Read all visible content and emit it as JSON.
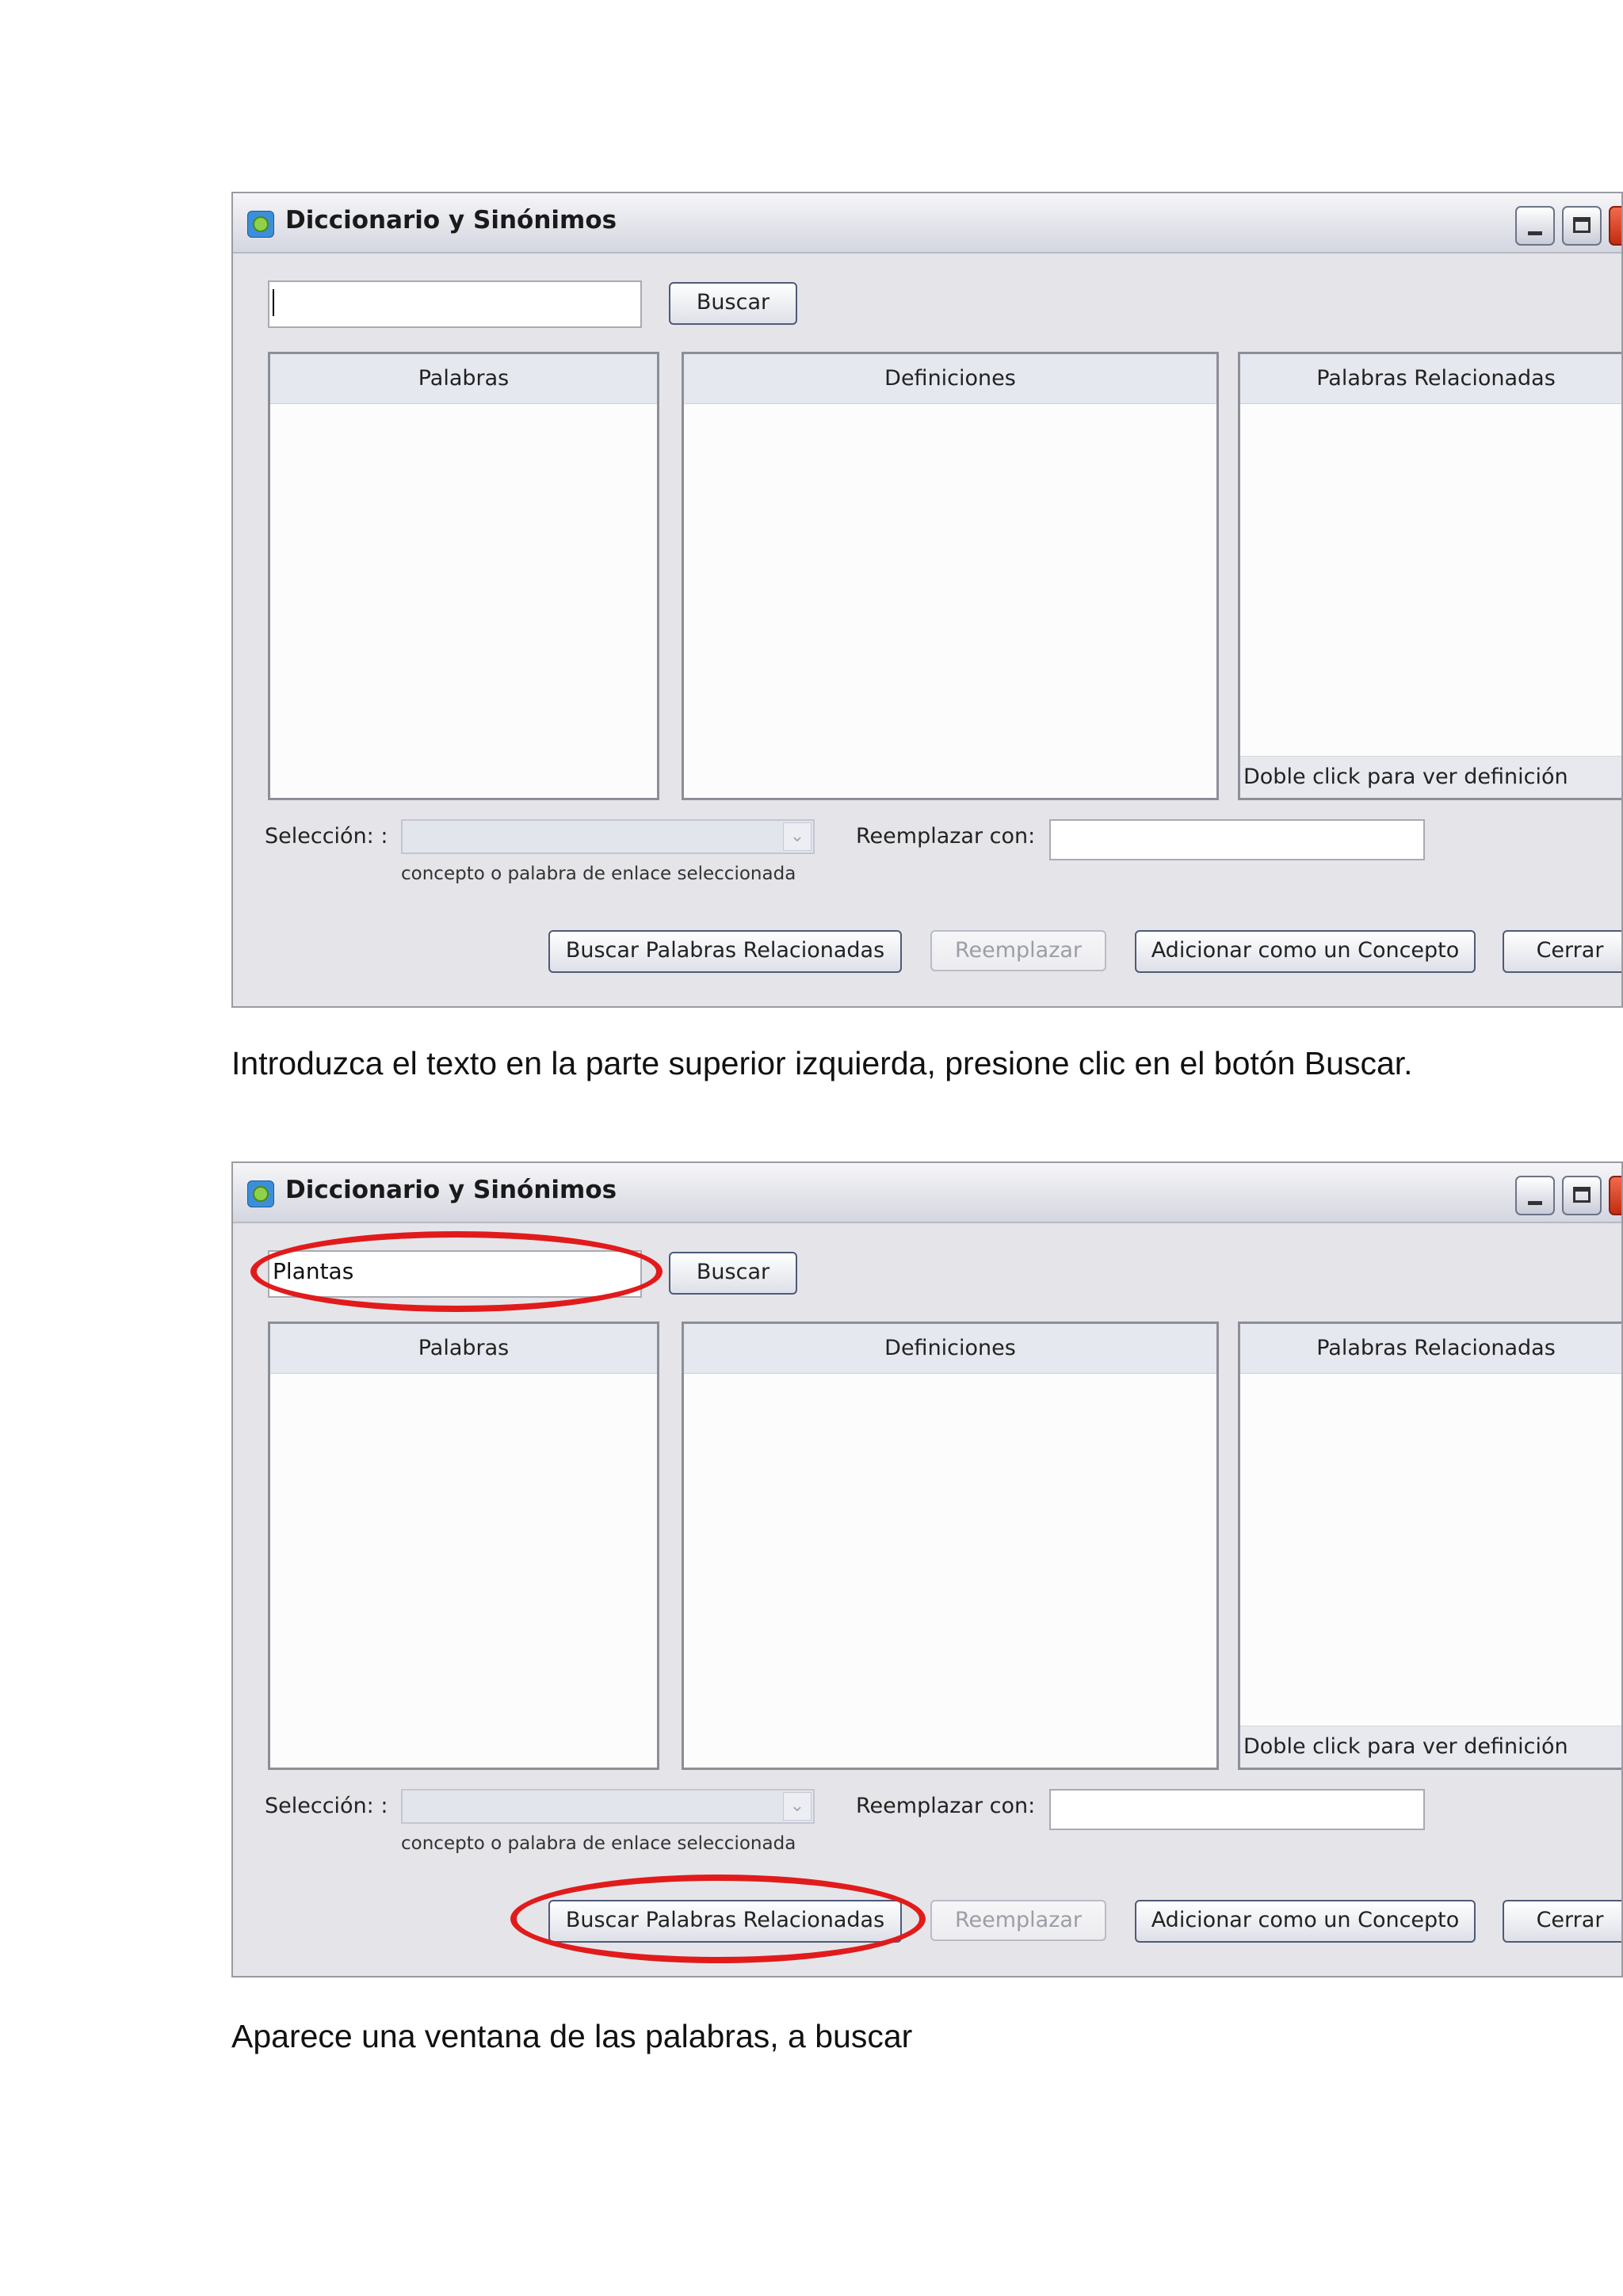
{
  "window1": {
    "title": "Diccionario y Sinónimos",
    "search_value": "",
    "buttons": {
      "search": "Buscar",
      "related": "Buscar Palabras Relacionadas",
      "replace": "Reemplazar",
      "add_concept": "Adicionar como un Concepto",
      "close": "Cerrar"
    },
    "panels": {
      "words_header": "Palabras",
      "definitions_header": "Definiciones",
      "related_header": "Palabras Relacionadas",
      "related_footer": "Doble click para ver definición"
    },
    "selection_label": "Selección: :",
    "selection_hint": "concepto o palabra de  enlace seleccionada",
    "replace_label": "Reemplazar con:",
    "replace_value": ""
  },
  "caption1": "Introduzca el texto en la parte superior izquierda, presione clic en el botón Buscar.",
  "window2": {
    "title": "Diccionario y Sinónimos",
    "search_value": "Plantas",
    "buttons": {
      "search": "Buscar",
      "related": "Buscar Palabras Relacionadas",
      "replace": "Reemplazar",
      "add_concept": "Adicionar como un Concepto",
      "close": "Cerrar"
    },
    "panels": {
      "words_header": "Palabras",
      "definitions_header": "Definiciones",
      "related_header": "Palabras Relacionadas",
      "related_footer": "Doble click para ver definición"
    },
    "selection_label": "Selección: :",
    "selection_hint": "concepto o palabra de  enlace seleccionada",
    "replace_label": "Reemplazar con:",
    "replace_value": ""
  },
  "caption2": "Aparece una ventana de las palabras, a buscar",
  "colors": {
    "highlight": "#e11b1b",
    "window_bg": "#e5e5e9"
  }
}
